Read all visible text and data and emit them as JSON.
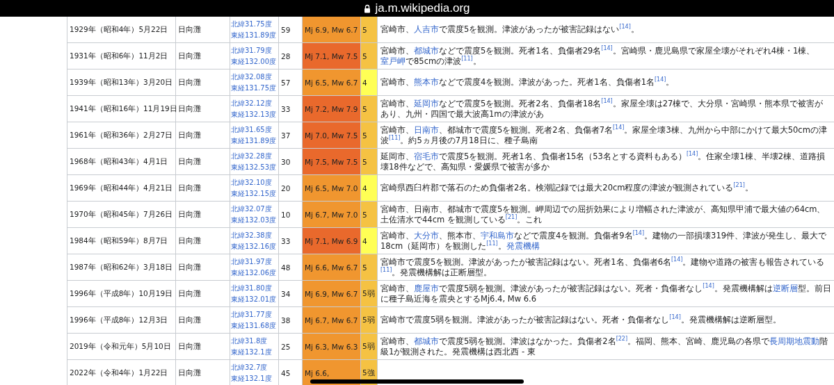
{
  "address_bar": {
    "url": "ja.m.wikipedia.org"
  },
  "rows": [
    {
      "date": "1929年（昭和4年）5月22日",
      "region": "日向灘",
      "coords": [
        "北緯31.75度",
        "東経131.89度"
      ],
      "depth": "59",
      "magnitude": {
        "text": "Mj 6.9, Mw 6.7",
        "color": "#f0962f"
      },
      "intensity": {
        "text": "5",
        "color": "#f5c243"
      },
      "description": [
        {
          "kind": "text",
          "text": "宮崎市、"
        },
        {
          "kind": "link",
          "text": "人吉市"
        },
        {
          "kind": "text",
          "text": "で震度5を観測。津波があったが被害記録はない"
        },
        {
          "kind": "ref",
          "text": "[14]"
        },
        {
          "kind": "text",
          "text": "。"
        }
      ]
    },
    {
      "date": "1931年（昭和6年）11月2日",
      "region": "日向灘",
      "coords": [
        "北緯31.79度",
        "東経132.00度"
      ],
      "depth": "28",
      "magnitude": {
        "text": "Mj 7.1, Mw 7.5",
        "color": "#e9692c"
      },
      "intensity": {
        "text": "5",
        "color": "#f5c243"
      },
      "description": [
        {
          "kind": "text",
          "text": "宮崎市、"
        },
        {
          "kind": "link",
          "text": "都城市"
        },
        {
          "kind": "text",
          "text": "などで震度5を観測。死者1名、負傷者29名"
        },
        {
          "kind": "ref",
          "text": "[14]"
        },
        {
          "kind": "text",
          "text": "。宮崎県・鹿児島県で家屋全壊がそれぞれ4棟・1棟、"
        },
        {
          "kind": "link",
          "text": "室戸岬"
        },
        {
          "kind": "text",
          "text": "で85cmの津波"
        },
        {
          "kind": "ref",
          "text": "[11]"
        },
        {
          "kind": "text",
          "text": "。"
        }
      ]
    },
    {
      "date": "1939年（昭和13年）3月20日",
      "region": "日向灘",
      "coords": [
        "北緯32.08度",
        "東経131.75度"
      ],
      "depth": "57",
      "magnitude": {
        "text": "Mj 6.5, Mw 6.7",
        "color": "#f0962f"
      },
      "intensity": {
        "text": "4",
        "color": "#ffff55"
      },
      "description": [
        {
          "kind": "text",
          "text": "宮崎市、"
        },
        {
          "kind": "link",
          "text": "熊本市"
        },
        {
          "kind": "text",
          "text": "などで震度4を観測。津波があった。死者1名、負傷者1名"
        },
        {
          "kind": "ref",
          "text": "[14]"
        },
        {
          "kind": "text",
          "text": "。"
        }
      ]
    },
    {
      "date": "1941年（昭和16年）11月19日",
      "region": "日向灘",
      "coords": [
        "北緯32.12度",
        "東経132.13度"
      ],
      "depth": "33",
      "magnitude": {
        "text": "Mj 7.2, Mw 7.9",
        "color": "#e9692c"
      },
      "intensity": {
        "text": "5",
        "color": "#f5c243"
      },
      "description": [
        {
          "kind": "text",
          "text": "宮崎市、"
        },
        {
          "kind": "link",
          "text": "延岡市"
        },
        {
          "kind": "text",
          "text": "などで震度5を観測。死者2名、負傷者18名"
        },
        {
          "kind": "ref",
          "text": "[14]"
        },
        {
          "kind": "text",
          "text": "。家屋全壊は27棟で、大分県・宮崎県・熊本県で被害があり、九州・四国で最大波高1mの津波があ"
        }
      ]
    },
    {
      "date": "1961年（昭和36年）2月27日",
      "region": "日向灘",
      "coords": [
        "北緯31.65度",
        "東経131.89度"
      ],
      "depth": "37",
      "magnitude": {
        "text": "Mj 7.0, Mw 7.5",
        "color": "#e9692c"
      },
      "intensity": {
        "text": "5",
        "color": "#f5c243"
      },
      "description": [
        {
          "kind": "text",
          "text": "宮崎市、"
        },
        {
          "kind": "link",
          "text": "日南市"
        },
        {
          "kind": "text",
          "text": "、都城市で震度5を観測。死者2名、負傷者7名"
        },
        {
          "kind": "ref",
          "text": "[14]"
        },
        {
          "kind": "text",
          "text": "。家屋全壊3棟、九州から中部にかけて最大50cmの津波"
        },
        {
          "kind": "ref",
          "text": "[11]"
        },
        {
          "kind": "text",
          "text": "。約5ヵ月後の7月18日に、種子島南"
        }
      ]
    },
    {
      "date": "1968年（昭和43年）4月1日",
      "region": "日向灘",
      "coords": [
        "北緯32.28度",
        "東経132.53度"
      ],
      "depth": "30",
      "magnitude": {
        "text": "Mj 7.5, Mw 7.5",
        "color": "#e9692c"
      },
      "intensity": {
        "text": "5",
        "color": "#f5c243"
      },
      "description": [
        {
          "kind": "text",
          "text": "延岡市、"
        },
        {
          "kind": "link",
          "text": "宿毛市"
        },
        {
          "kind": "text",
          "text": "で震度5を観測。死者1名、負傷者15名（53名とする資料もある）"
        },
        {
          "kind": "ref",
          "text": "[14]"
        },
        {
          "kind": "text",
          "text": "。住家全壊1棟、半壊2棟、道路損壊18件などで、高知県・愛媛県で被害が多か"
        }
      ]
    },
    {
      "date": "1969年（昭和44年）4月21日",
      "region": "日向灘",
      "coords": [
        "北緯32.10度",
        "東経132.15度"
      ],
      "depth": "20",
      "magnitude": {
        "text": "Mj 6.5, Mw 7.0",
        "color": "#f0962f"
      },
      "intensity": {
        "text": "4",
        "color": "#ffff55"
      },
      "description": [
        {
          "kind": "text",
          "text": "宮崎県西臼杵郡で落石のため負傷者2名。検潮記録では最大20cm程度の津波が観測されている"
        },
        {
          "kind": "ref",
          "text": "[21]"
        },
        {
          "kind": "text",
          "text": "。"
        }
      ]
    },
    {
      "date": "1970年（昭和45年）7月26日",
      "region": "日向灘",
      "coords": [
        "北緯32.07度",
        "東経132.03度"
      ],
      "depth": "10",
      "magnitude": {
        "text": "Mj 6.7, Mw 7.0",
        "color": "#f0962f"
      },
      "intensity": {
        "text": "5",
        "color": "#f5c243"
      },
      "description": [
        {
          "kind": "text",
          "text": "宮崎市、日南市、都城市で震度5を観測。岬周辺での屈折効果により増幅された津波が、高知県甲浦で最大値の64cm、土佐清水で44cm を観測している"
        },
        {
          "kind": "ref",
          "text": "[21]"
        },
        {
          "kind": "text",
          "text": "。これ"
        }
      ]
    },
    {
      "date": "1984年（昭和59年）8月7日",
      "region": "日向灘",
      "coords": [
        "北緯32.38度",
        "東経132.16度"
      ],
      "depth": "33",
      "magnitude": {
        "text": "Mj 7.1, Mw 6.9",
        "color": "#e9692c"
      },
      "intensity": {
        "text": "4",
        "color": "#ffff55"
      },
      "description": [
        {
          "kind": "text",
          "text": "宮崎市、"
        },
        {
          "kind": "link",
          "text": "大分市"
        },
        {
          "kind": "text",
          "text": "、熊本市、"
        },
        {
          "kind": "link",
          "text": "宇和島市"
        },
        {
          "kind": "text",
          "text": "などで震度4を観測。負傷者9名"
        },
        {
          "kind": "ref",
          "text": "[14]"
        },
        {
          "kind": "text",
          "text": "。建物の一部損壊319件、津波が発生し、最大で18cm（延岡市）を観測した"
        },
        {
          "kind": "ref",
          "text": "[11]"
        },
        {
          "kind": "text",
          "text": "。"
        },
        {
          "kind": "link",
          "text": "発震機構"
        }
      ]
    },
    {
      "date": "1987年（昭和62年）3月18日",
      "region": "日向灘",
      "coords": [
        "北緯31.97度",
        "東経132.06度"
      ],
      "depth": "48",
      "magnitude": {
        "text": "Mj 6.6, Mw 6.7",
        "color": "#f0962f"
      },
      "intensity": {
        "text": "5",
        "color": "#f5c243"
      },
      "description": [
        {
          "kind": "text",
          "text": "宮崎市で震度5を観測。津波があったが被害記録はない。死者1名、負傷者6名"
        },
        {
          "kind": "ref",
          "text": "[14]"
        },
        {
          "kind": "text",
          "text": "。建物や道路の被害も報告されている"
        },
        {
          "kind": "ref",
          "text": "[11]"
        },
        {
          "kind": "text",
          "text": "。発震機構解は正断層型。"
        }
      ]
    },
    {
      "date": "1996年（平成8年）10月19日",
      "region": "日向灘",
      "coords": [
        "北緯31.80度",
        "東経132.01度"
      ],
      "depth": "34",
      "magnitude": {
        "text": "Mj 6.9, Mw 6.7",
        "color": "#f0962f"
      },
      "intensity": {
        "text": "5弱",
        "color": "#f5c243"
      },
      "description": [
        {
          "kind": "text",
          "text": "宮崎市、"
        },
        {
          "kind": "link",
          "text": "鹿屋市"
        },
        {
          "kind": "text",
          "text": "で震度5弱を観測。津波があったが被害記録はない。死者・負傷者なし"
        },
        {
          "kind": "ref",
          "text": "[14]"
        },
        {
          "kind": "text",
          "text": "。発震機構解は"
        },
        {
          "kind": "link",
          "text": "逆断層"
        },
        {
          "kind": "text",
          "text": "型。前日に種子島近海を震央とするMj6.4, Mw 6.6"
        }
      ]
    },
    {
      "date": "1996年（平成8年）12月3日",
      "region": "日向灘",
      "coords": [
        "北緯31.77度",
        "東経131.68度"
      ],
      "depth": "38",
      "magnitude": {
        "text": "Mj 6.7, Mw 6.7",
        "color": "#f0962f"
      },
      "intensity": {
        "text": "5弱",
        "color": "#f5c243"
      },
      "description": [
        {
          "kind": "text",
          "text": "宮崎市で震度5弱を観測。津波があったが被害記録はない。死者・負傷者なし"
        },
        {
          "kind": "ref",
          "text": "[14]"
        },
        {
          "kind": "text",
          "text": "。発震機構解は逆断層型。"
        }
      ]
    },
    {
      "date": "2019年（令和元年）5月10日",
      "region": "日向灘",
      "coords": [
        "北緯31.8度",
        "東経132.1度"
      ],
      "depth": "25",
      "magnitude": {
        "text": "Mj 6.3, Mw 6.3",
        "color": "#f0962f"
      },
      "intensity": {
        "text": "5弱",
        "color": "#f5c243"
      },
      "description": [
        {
          "kind": "text",
          "text": "宮崎市、"
        },
        {
          "kind": "link",
          "text": "都城市"
        },
        {
          "kind": "text",
          "text": "で震度5弱を観測。津波はなかった。負傷者2名"
        },
        {
          "kind": "ref",
          "text": "[22]"
        },
        {
          "kind": "text",
          "text": "。福岡、熊本、宮崎、鹿児島の各県で"
        },
        {
          "kind": "link",
          "text": "長周期地震動"
        },
        {
          "kind": "text",
          "text": "階級1が観測された。発震機構は西北西 - 東"
        }
      ]
    },
    {
      "date": "2022年（令和4年）1月22日",
      "region": "日向灘",
      "coords": [
        "北緯32.7度",
        "東経132.1度"
      ],
      "depth": "45",
      "magnitude": {
        "text": "Mj 6.6,",
        "color": "#f0962f"
      },
      "intensity": {
        "text": "5強",
        "color": "#f5c243"
      },
      "description": []
    }
  ]
}
